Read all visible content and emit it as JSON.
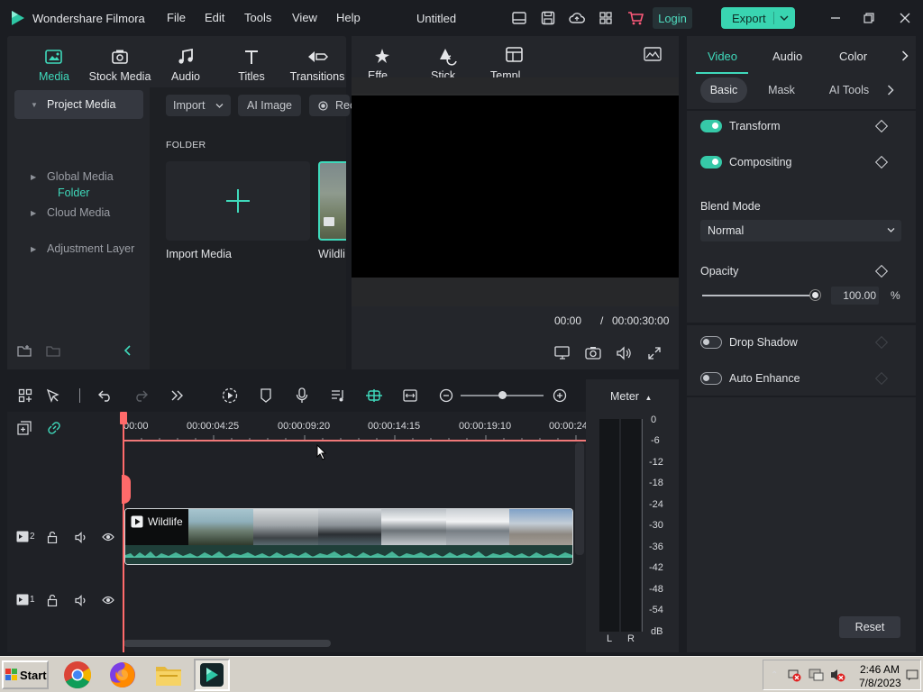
{
  "app": {
    "name": "Wondershare Filmora",
    "menu": [
      "File",
      "Edit",
      "Tools",
      "View",
      "Help"
    ],
    "document_title": "Untitled",
    "login_label": "Login",
    "export_label": "Export"
  },
  "media_panel": {
    "tabs": [
      {
        "label": "Media",
        "icon": "media-icon",
        "active": true
      },
      {
        "label": "Stock Media",
        "icon": "stock-media-icon",
        "active": false
      },
      {
        "label": "Audio",
        "icon": "music-note-icon",
        "active": false
      },
      {
        "label": "Titles",
        "icon": "text-t-icon",
        "active": false
      },
      {
        "label": "Transitions",
        "icon": "transition-arrows-icon",
        "active": false
      }
    ],
    "sidebar": {
      "project_media": "Project Media",
      "folder": "Folder",
      "global_media": "Global Media",
      "cloud_media": "Cloud Media",
      "adjustment_layer": "Adjustment Layer"
    },
    "toolbar": {
      "import": "Import",
      "ai_image": "AI Image",
      "record": "Rec"
    },
    "folder_caption": "FOLDER",
    "items": [
      {
        "label": "Import Media",
        "icon": "plus-icon"
      },
      {
        "label": "Wildli"
      }
    ]
  },
  "player": {
    "tabs_partial": [
      {
        "label": "Effe",
        "icon": "effects-icon"
      },
      {
        "label": "Stick",
        "icon": "stickers-icon"
      },
      {
        "label": "Templ",
        "icon": "templates-icon"
      }
    ],
    "current_time": "00:00",
    "separator": "/",
    "duration": "00:00:30:00"
  },
  "properties": {
    "tabs": [
      {
        "label": "Video",
        "active": true
      },
      {
        "label": "Audio",
        "active": false
      },
      {
        "label": "Color",
        "active": false
      }
    ],
    "subtabs": [
      {
        "label": "Basic",
        "active": true
      },
      {
        "label": "Mask",
        "active": false
      },
      {
        "label": "AI Tools",
        "active": false
      }
    ],
    "transform": {
      "label": "Transform",
      "enabled": true
    },
    "compositing": {
      "label": "Compositing",
      "enabled": true
    },
    "blend_mode": {
      "label": "Blend Mode",
      "value": "Normal"
    },
    "opacity": {
      "label": "Opacity",
      "value": "100.00",
      "unit": "%",
      "fraction": 1.0
    },
    "drop_shadow": {
      "label": "Drop Shadow",
      "enabled": false
    },
    "auto_enhance": {
      "label": "Auto Enhance",
      "enabled": false
    },
    "reset_label": "Reset"
  },
  "timeline": {
    "ruler_labels": [
      "00:00",
      "00:00:04:25",
      "00:00:09:20",
      "00:00:14:15",
      "00:00:19:10",
      "00:00:24"
    ],
    "tracks": [
      {
        "number": "2",
        "clip": "Wildlife"
      },
      {
        "number": "1",
        "clip": ""
      }
    ]
  },
  "meter": {
    "label": "Meter",
    "scale": [
      "0",
      "-6",
      "-12",
      "-18",
      "-24",
      "-30",
      "-36",
      "-42",
      "-48",
      "-54",
      "dB"
    ],
    "left": "L",
    "right": "R"
  },
  "taskbar": {
    "start_label": "Start",
    "apps": [
      "chrome-icon",
      "firefox-icon",
      "file-explorer-icon",
      "filmora-icon"
    ],
    "time": "2:46 AM",
    "date": "7/8/2023"
  },
  "colors": {
    "accent": "#3fd9bb",
    "export": "#39d5b1",
    "playhead": "#ff6a6a"
  }
}
